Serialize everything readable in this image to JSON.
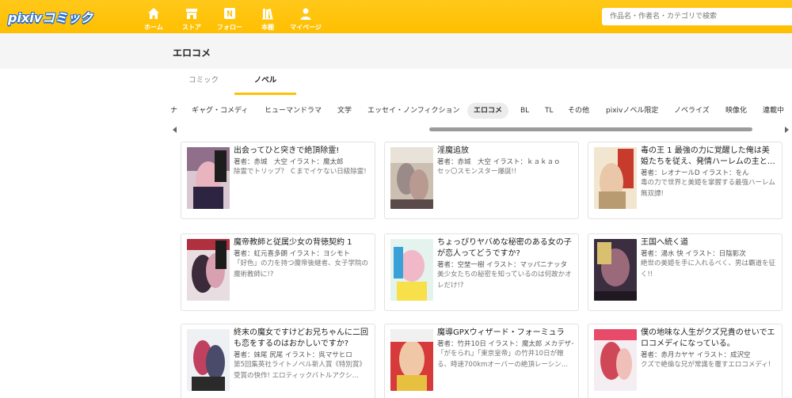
{
  "header": {
    "logo": "pixivコミック",
    "nav": [
      {
        "label": "ホーム",
        "icon": "home-icon"
      },
      {
        "label": "ストア",
        "icon": "store-icon"
      },
      {
        "label": "フォロー",
        "icon": "follow-icon"
      },
      {
        "label": "本棚",
        "icon": "bookshelf-icon"
      },
      {
        "label": "マイページ",
        "icon": "user-icon"
      }
    ],
    "search_placeholder": "作品名・作者名・カテゴリで検索"
  },
  "page": {
    "title": "エロコメ"
  },
  "tabs": [
    {
      "label": "コミック",
      "active": false
    },
    {
      "label": "ノベル",
      "active": true
    }
  ],
  "genres": [
    {
      "label": "ナ",
      "active": false
    },
    {
      "label": "ギャグ・コメディ",
      "active": false
    },
    {
      "label": "ヒューマンドラマ",
      "active": false
    },
    {
      "label": "文学",
      "active": false
    },
    {
      "label": "エッセイ・ノンフィクション",
      "active": false
    },
    {
      "label": "エロコメ",
      "active": true
    },
    {
      "label": "BL",
      "active": false
    },
    {
      "label": "TL",
      "active": false
    },
    {
      "label": "その他",
      "active": false
    },
    {
      "label": "pixivノベル限定",
      "active": false
    },
    {
      "label": "ノベライズ",
      "active": false
    },
    {
      "label": "映像化",
      "active": false
    },
    {
      "label": "連載中",
      "active": false
    }
  ],
  "colors": {
    "accent": "#ffc107",
    "card_border": "#e2e2e2"
  },
  "books": [
    {
      "title": "出会ってひと突きで絶頂除霊!",
      "authors": "著者：赤城　大空 イラスト：魔太郎",
      "description": "除霊でトリップ？ Ｃまでイケない日級除霊!"
    },
    {
      "title": "淫魔追放",
      "authors": "著者：赤城　大空 イラスト：ｋａｋａｏ",
      "description": "セッ〇スモンスター爆誕!!"
    },
    {
      "title": "毒の王 1 最強の力に覚醒した俺は美姫たちを従え、発情ハーレムの主と…",
      "authors": "著者：レオナールD イラスト：をん",
      "description": "毒の力で世界と美姫を掌握する最強ハーレム無双譚!"
    },
    {
      "title": "魔帝教師と従属少女の背徳契約 1",
      "authors": "著者：虹元喜多朗 イラスト：ヨシモト",
      "description": "「好色」の力を持つ魔帝後継者、女子学院の魔術教師に!?"
    },
    {
      "title": "ちょっぴりヤバめな秘密のある女の子が恋人ってどうですか?",
      "authors": "著者：空埜一樹 イラスト：マッパニナッタ",
      "description": "美少女たちの秘密を知っているのは何故かオレだけ!?"
    },
    {
      "title": "王国へ続く道",
      "authors": "著者：湯水 快 イラスト：日陰影次",
      "description": "絶世の美姫を手に入れるべく、男は覇道を征く!!"
    },
    {
      "title": "終末の魔女ですけどお兄ちゃんに二回も恋をするのはおかしいですか?",
      "authors": "著者：妹尾 尻尾 イラスト：呉マサヒロ",
      "description": "第5回集英社ライトノベル新人賞《特別賞》受賞の快作! エロティックバトルアクシ…"
    },
    {
      "title": "魔導GPXウィザード・フォーミュラ",
      "authors": "著者：竹井10日 イラスト：魔太郎 メカデザイン：大豚",
      "description": "「がをられ」「東京皇帝」の竹井10日が贈る、時速700kmオーバーの絶頂レーシン…"
    },
    {
      "title": "僕の地味な人生がクズ兄貴のせいでエロコメディになっている。",
      "authors": "著者：赤月カヤヤ イラスト：成沢空",
      "description": "クズで絶倫な兄が常識を覆すエロコメディ!"
    }
  ]
}
